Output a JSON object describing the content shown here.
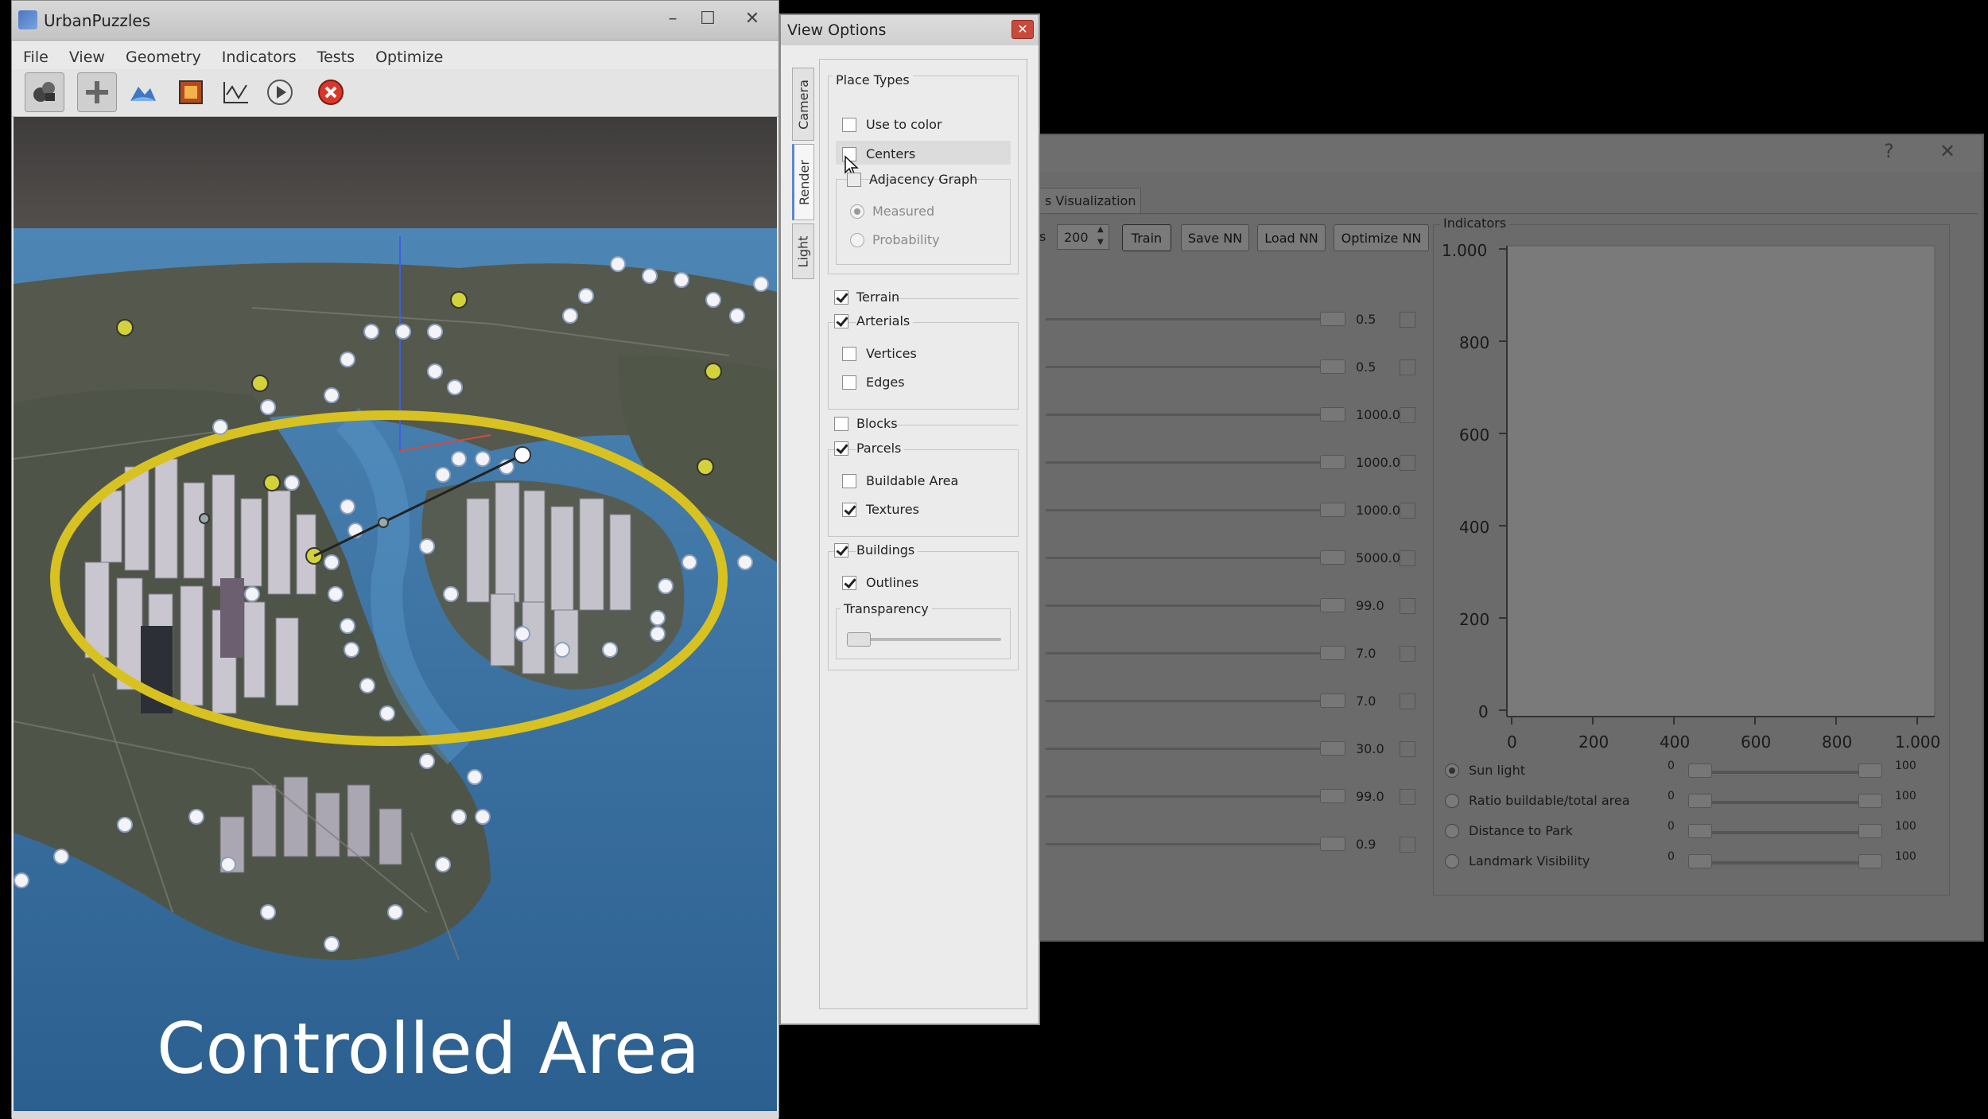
{
  "main_window": {
    "title": "UrbanPuzzles",
    "menu": [
      "File",
      "View",
      "Geometry",
      "Indicators",
      "Tests",
      "Optimize"
    ],
    "toolbar_icons": [
      "camera-icon",
      "add-icon",
      "terrain-icon",
      "image-icon",
      "graph-icon",
      "play-icon",
      "stop-icon"
    ],
    "caption": "Controlled Area"
  },
  "view_options": {
    "title": "View Options",
    "close_glyph": "✕",
    "tabs": [
      "Camera",
      "Render",
      "Light"
    ],
    "active_tab": "Render",
    "place_types": {
      "label": "Place Types",
      "use_to_color": "Use to color",
      "centers": "Centers",
      "adjacency_graph": "Adjacency Graph",
      "measured": "Measured",
      "probability": "Probability"
    },
    "terrain": "Terrain",
    "arterials": "Arterials",
    "vertices": "Vertices",
    "edges": "Edges",
    "blocks": "Blocks",
    "parcels": "Parcels",
    "buildable_area": "Buildable Area",
    "textures": "Textures",
    "buildings": "Buildings",
    "outlines": "Outlines",
    "transparency": "Transparency"
  },
  "dialog": {
    "help_glyph": "?",
    "close_glyph": "✕",
    "tab_label": "s Visualization",
    "prefix": "s",
    "spin_value": "200",
    "buttons": {
      "train": "Train",
      "save": "Save NN",
      "load": "Load NN",
      "optimize": "Optimize NN"
    },
    "rows": [
      "0.5",
      "0.5",
      "1000.0",
      "1000.0",
      "1000.0",
      "5000.0",
      "99.0",
      "7.0",
      "7.0",
      "30.0",
      "99.0",
      "0.9"
    ],
    "indicators": {
      "label": "Indicators",
      "y_ticks": [
        "1.000",
        "800",
        "600",
        "400",
        "200",
        "0"
      ],
      "x_ticks": [
        "0",
        "200",
        "400",
        "600",
        "800",
        "1.000"
      ],
      "items": [
        {
          "label": "Sun light",
          "min": "0",
          "max": "100",
          "selected": true
        },
        {
          "label": "Ratio buildable/total area",
          "min": "0",
          "max": "100",
          "selected": false
        },
        {
          "label": "Distance to Park",
          "min": "0",
          "max": "100",
          "selected": false
        },
        {
          "label": "Landmark Visibility",
          "min": "0",
          "max": "100",
          "selected": false
        }
      ]
    }
  }
}
